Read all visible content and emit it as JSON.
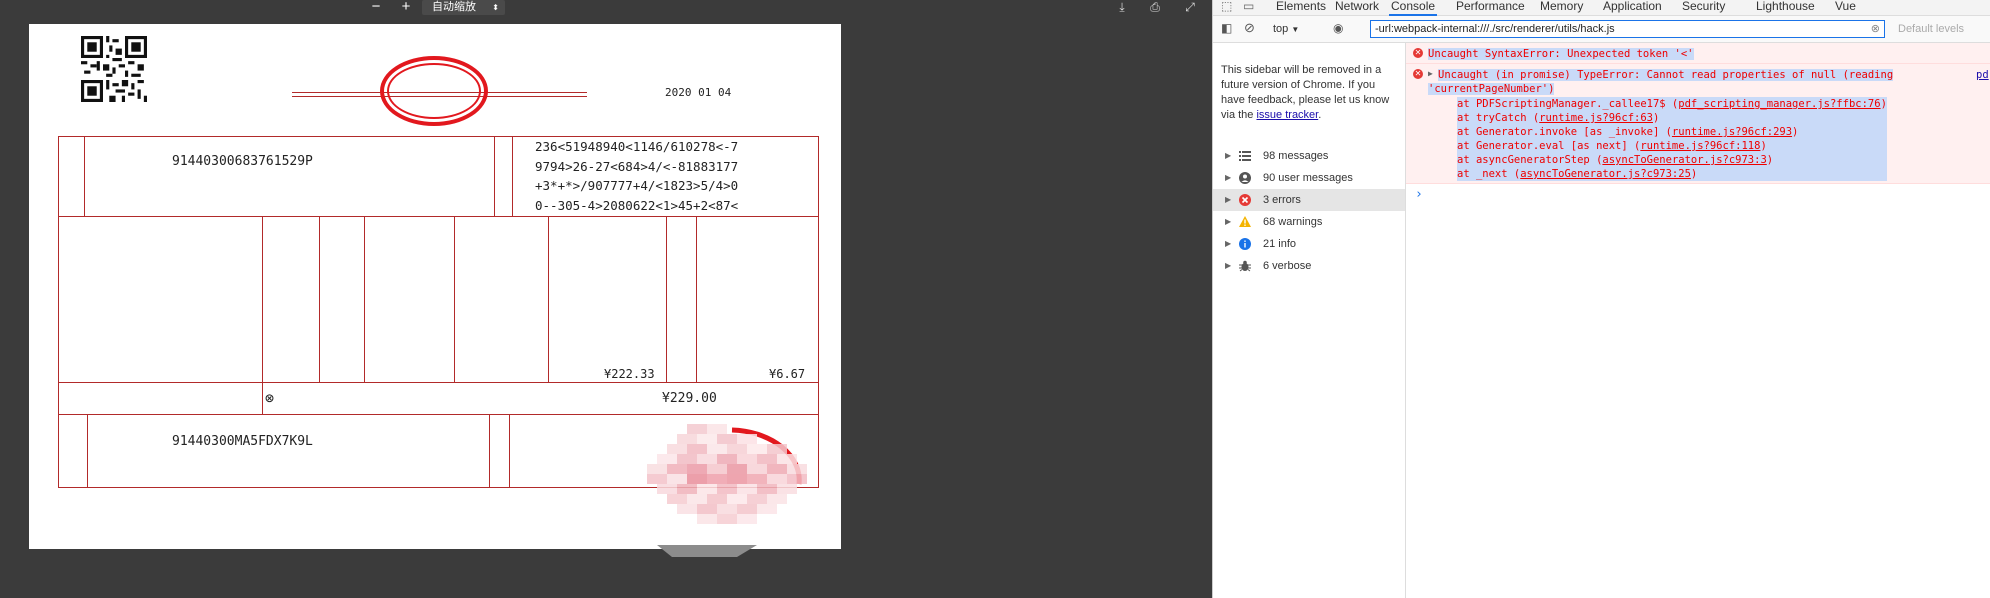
{
  "pdf_viewer": {
    "toolbar": {
      "zoom_out": "−",
      "zoom_in": "+",
      "zoom_value": "自动缩放"
    },
    "invoice": {
      "date": "2020  01  04",
      "buyer_tax_id": "91440300683761529P",
      "cipher_lines": [
        "236<51948940<1146/610278<-7",
        "9794>26-27<684>4/<-81883177",
        "+3*+*>/907777+4/<1823>5/4>0",
        "0--305-4>2080622<1>45+2<87<"
      ],
      "amount": "¥222.33",
      "tax": "¥6.67",
      "total_symbol": "⊗",
      "total": "¥229.00",
      "seller_tax_id": "91440300MA5FDX7K9L"
    }
  },
  "devtools": {
    "tabs": [
      "Elements",
      "Network",
      "Console",
      "Performance",
      "Memory",
      "Application",
      "Security",
      "Lighthouse",
      "Vue"
    ],
    "active_tab": "Console",
    "context": "top",
    "filter_value": "-url:webpack-internal:///./src/renderer/utils/hack.js",
    "levels": "Default levels",
    "sidebar_note": "This sidebar will be removed in a future version of Chrome. If you have feedback, please let us know via the",
    "sidebar_note_link": "issue tracker",
    "sidebar_note_end": ".",
    "sidebar_items": [
      {
        "label": "98 messages",
        "icon": "list-icon"
      },
      {
        "label": "90 user messages",
        "icon": "user-icon"
      },
      {
        "label": "3 errors",
        "icon": "error-icon"
      },
      {
        "label": "68 warnings",
        "icon": "warning-icon"
      },
      {
        "label": "21 info",
        "icon": "info-icon"
      },
      {
        "label": "6 verbose",
        "icon": "bug-icon"
      }
    ],
    "log": {
      "error1": "Uncaught SyntaxError: Unexpected token '<'",
      "error2_head": "Uncaught (in promise) TypeError: Cannot read properties of null (reading",
      "error2_head2": "'currentPageNumber')",
      "error2_source": "pd",
      "stack": [
        {
          "text": "at PDFScriptingManager._callee17$ (",
          "link": "pdf_scripting_manager.js?ffbc:76",
          "end": ")"
        },
        {
          "text": "at tryCatch (",
          "link": "runtime.js?96cf:63",
          "end": ")"
        },
        {
          "text": "at Generator.invoke [as _invoke] (",
          "link": "runtime.js?96cf:293",
          "end": ")"
        },
        {
          "text": "at Generator.eval [as next] (",
          "link": "runtime.js?96cf:118",
          "end": ")"
        },
        {
          "text": "at asyncGeneratorStep (",
          "link": "asyncToGenerator.js?c973:3",
          "end": ")"
        },
        {
          "text": "at _next (",
          "link": "asyncToGenerator.js?c973:25",
          "end": ")"
        }
      ],
      "prompt": "›"
    }
  }
}
